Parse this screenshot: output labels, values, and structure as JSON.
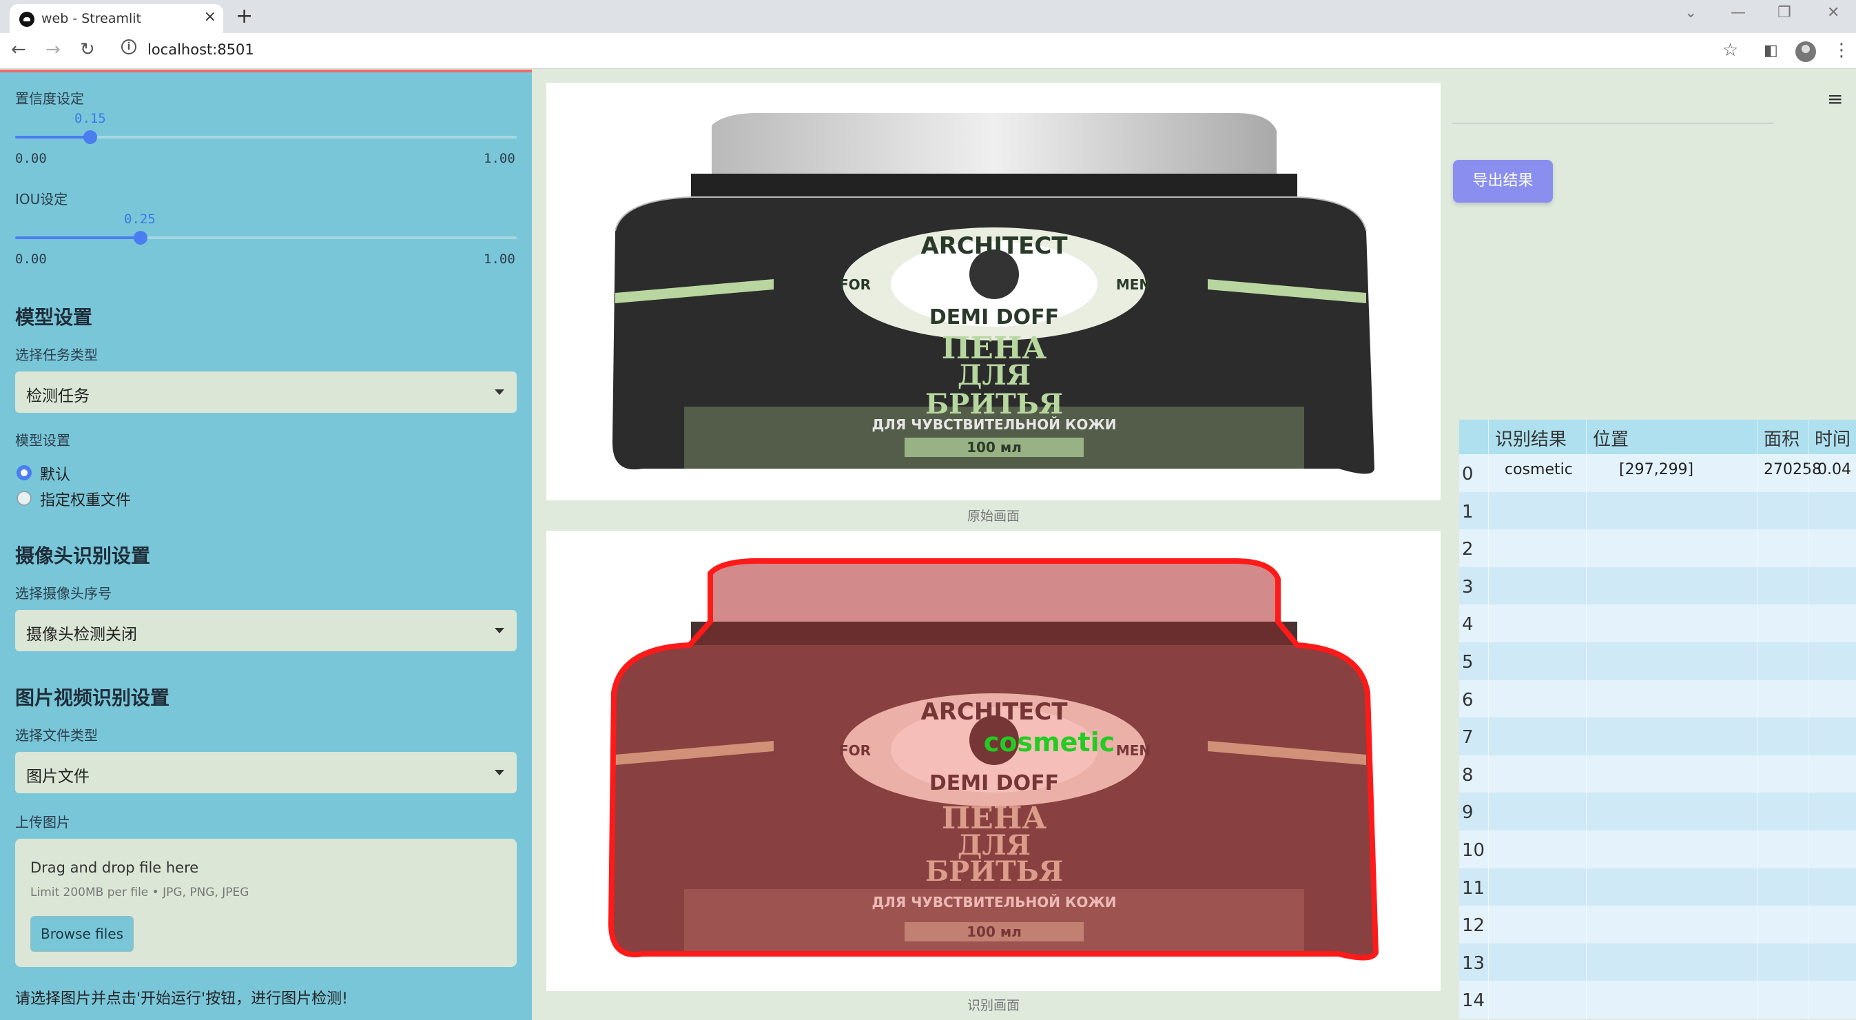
{
  "browser": {
    "tab_title": "web - Streamlit",
    "tab_close": "×",
    "new_tab": "+",
    "url": "localhost:8501"
  },
  "sidebar": {
    "confidence": {
      "label": "置信度设定",
      "value": "0.15",
      "value_num": 0.15,
      "min": "0.00",
      "max": "1.00"
    },
    "iou": {
      "label": "IOU设定",
      "value": "0.25",
      "value_num": 0.25,
      "min": "0.00",
      "max": "1.00"
    },
    "model_header": "模型设置",
    "task_label": "选择任务类型",
    "task_value": "检测任务",
    "model_label": "模型设置",
    "model_options": [
      "默认",
      "指定权重文件"
    ],
    "model_selected": "默认",
    "camera_header": "摄像头识别设置",
    "camera_label": "选择摄像头序号",
    "camera_value": "摄像头检测关闭",
    "media_header": "图片视频识别设置",
    "filetype_label": "选择文件类型",
    "filetype_value": "图片文件",
    "upload_label": "上传图片",
    "upload_title": "Drag and drop file here",
    "upload_limit": "Limit 200MB per file • JPG, PNG, JPEG",
    "browse_label": "Browse files",
    "note": "请选择图片并点击'开始运行'按钮，进行图片检测!"
  },
  "main": {
    "original_caption": "原始画面",
    "result_caption": "识别画面",
    "detection_label": "cosmetic",
    "product_text": {
      "brand": "ARCHITECT",
      "for": "FOR",
      "men": "MEN",
      "line": "DEMI DOFF",
      "title1": "ПЕНА",
      "title2": "ДЛЯ",
      "title3": "БРИТЬЯ",
      "subtitle": "ДЛЯ ЧУВСТВИТЕЛЬНОЙ КОЖИ",
      "volume": "100 мл"
    }
  },
  "right": {
    "export_label": "导出结果",
    "table": {
      "columns": [
        "识别结果",
        "位置",
        "面积",
        "时间"
      ],
      "rows": [
        {
          "index": "0",
          "result": "cosmetic",
          "position": "[297,299]",
          "area": "270258",
          "time": "0.04"
        },
        {
          "index": "1"
        },
        {
          "index": "2"
        },
        {
          "index": "3"
        },
        {
          "index": "4"
        },
        {
          "index": "5"
        },
        {
          "index": "6"
        },
        {
          "index": "7"
        },
        {
          "index": "8"
        },
        {
          "index": "9"
        },
        {
          "index": "10"
        },
        {
          "index": "11"
        },
        {
          "index": "12"
        },
        {
          "index": "13"
        },
        {
          "index": "14"
        }
      ]
    }
  },
  "colors": {
    "sidebar": "#79c6d9",
    "accent": "#4a7df0",
    "export": "#8a8fef",
    "detection": "#ff1a1a",
    "label": "#22cc22"
  }
}
